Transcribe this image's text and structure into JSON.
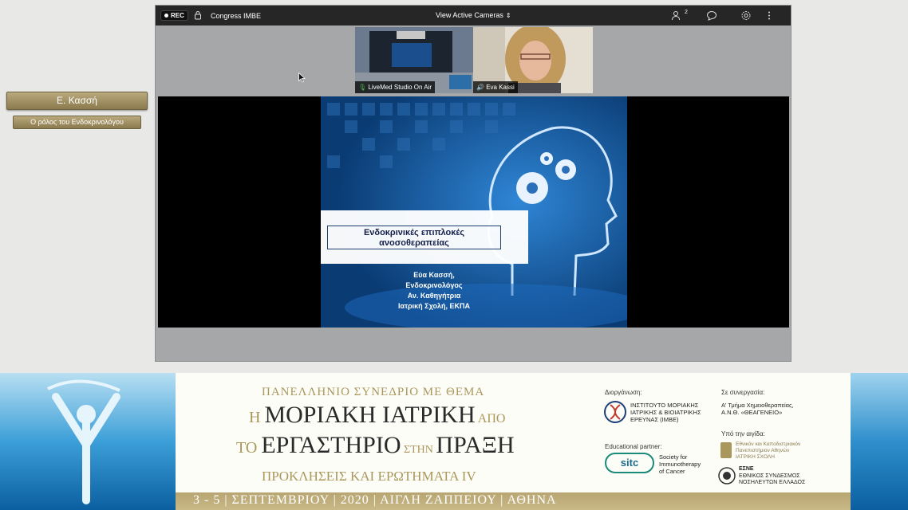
{
  "speaker": {
    "name": "Ε. Κασσή",
    "topic": "Ο ρόλος του Ενδοκρινολόγου"
  },
  "topbar": {
    "rec_label": "REC",
    "meeting_title": "Congress IMBE",
    "view_label": "View Active Cameras",
    "participants_count": "2",
    "icons": [
      "lock-icon",
      "participants-icon",
      "chat-icon",
      "settings-icon",
      "more-vert-icon"
    ]
  },
  "cameras": [
    {
      "label": "LiveMed Studio On Air",
      "icon": "microphone-icon"
    },
    {
      "label": "Eva Kassi",
      "icon": "speaker-icon"
    }
  ],
  "slide": {
    "title_line1": "Ενδοκρινικές επιπλοκές",
    "title_line2": "ανοσοθεραπείας",
    "author": [
      "Εύα Κασσή,",
      "Ενδοκρινολόγος",
      "Αν. Καθηγήτρια",
      "Ιατρική Σχολή, ΕΚΠΑ"
    ]
  },
  "banner": {
    "line1": "ΠΑΝΕΛΛΗΝΙΟ ΣΥΝΕΔΡΙΟ ΜΕ ΘΕΜΑ",
    "line2a": "Η ",
    "line2b": "ΜΟΡΙΑΚΗ ΙΑΤΡΙΚΗ",
    "line2c": " ΑΠΟ",
    "line3a": "ΤΟ ",
    "line3b": "ΕΡΓΑΣΤΗΡΙΟ",
    "line3c": " ΣΤΗΝ ",
    "line3d": "ΠΡΑΞΗ",
    "line4": "ΠΡΟΚΛΗΣΕΙΣ ΚΑΙ ΕΡΩΤΗΜΑΤΑ IV",
    "dates": "3 - 5 | ΣΕΠΤΕΜΒΡΙΟΥ | 2020 | ΑΙΓΛΗ ΖΑΠΠΕΙΟΥ | ΑΘΗΝΑ",
    "organized_label": "Διοργάνωση:",
    "organizer": [
      "ΙΝΣΤΙΤΟΥΤΟ ΜΟΡΙΑΚΗΣ",
      "ΙΑΤΡΙΚΗΣ & ΒΙΟΙΑΤΡΙΚΗΣ",
      "ΕΡΕΥΝΑΣ (IMBE)"
    ],
    "edu_label": "Educational partner:",
    "sitc": "sitc",
    "sitc_name": [
      "Society for",
      "Immunotherapy",
      "of Cancer"
    ],
    "collab_label": "Σε συνεργασία:",
    "collab": [
      "Α' Τμήμα Χημειοθεραπείας,",
      "Α.Ν.Θ. «ΘΕΑΓΕΝΕΙΟ»"
    ],
    "aegis_label": "Υπό την αιγίδα:",
    "aegis1": [
      "Εθνικόν και Καποδιστριακόν",
      "Πανεπιστήμιον Αθηνών",
      "ΙΑΤΡΙΚΗ ΣΧΟΛΗ"
    ],
    "aegis2": [
      "ΕΣΝΕ",
      "ΕΘΝΙΚΟΣ ΣΥΝΔΕΣΜΟΣ",
      "ΝΟΣΗΛΕΥΤΩΝ ΕΛΛΑΔΟΣ"
    ]
  },
  "colors": {
    "gold": "#a9975b",
    "topbar": "#262626",
    "slide_blue": "#0d4d8a"
  }
}
